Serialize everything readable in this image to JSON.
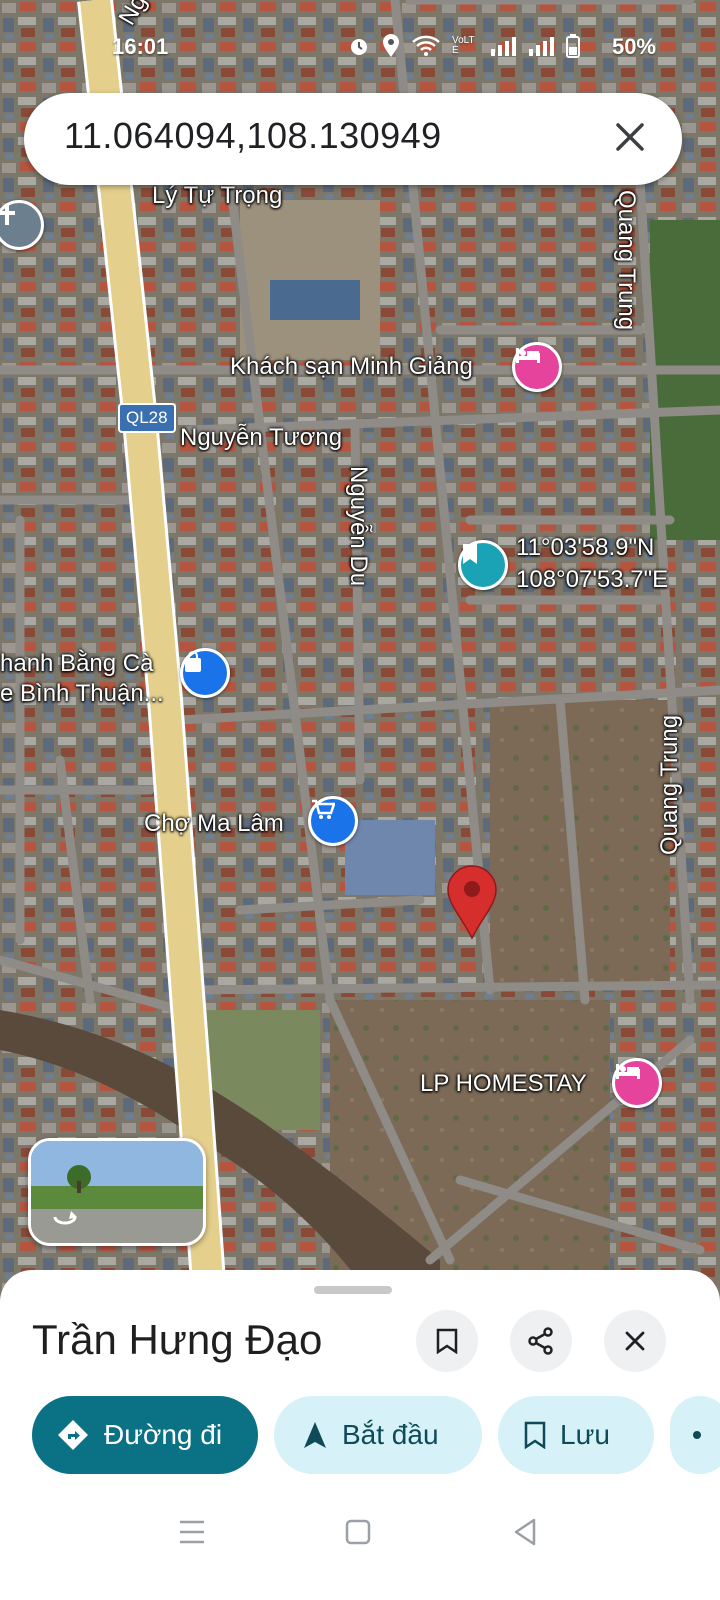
{
  "status_bar": {
    "time": "16:01",
    "battery": "50%",
    "net_label": "VoLTE"
  },
  "search": {
    "query": "11.064094,108.130949"
  },
  "map": {
    "road_shield": "QL28",
    "labels": {
      "ly_tu_trong": "Lý Tự Trọng",
      "nguyen_tuong": "Nguyễn Tương",
      "nguyen_du": "Nguyễn Du",
      "quang_trung_top": "Quang Trung",
      "quang_trung_bottom": "Quang Trung",
      "road_top_partial": "Ng"
    },
    "pois": {
      "hotel": "Khách sạn Minh Giảng",
      "coords_line1": "11°03'58.9\"N",
      "coords_line2": "108°07'53.7\"E",
      "shop_line1": "hanh Bằng Cà",
      "shop_line2": "e Bình Thuận...",
      "market": "Chợ Ma Lâm",
      "homestay": "LP HOMESTAY"
    },
    "colors": {
      "hotel_pin": "#e5439c",
      "bookmark_pin": "#1aa3b5",
      "shop_pin": "#1a73e8",
      "market_pin": "#1a73e8",
      "marker": "#d62d2d"
    }
  },
  "sheet": {
    "title": "Trần Hưng Đạo",
    "actions": {
      "directions": "Đường đi",
      "start": "Bắt đầu",
      "save": "Lưu"
    },
    "colors": {
      "primary": "#0b7285",
      "secondary": "#d6f1f7"
    }
  }
}
